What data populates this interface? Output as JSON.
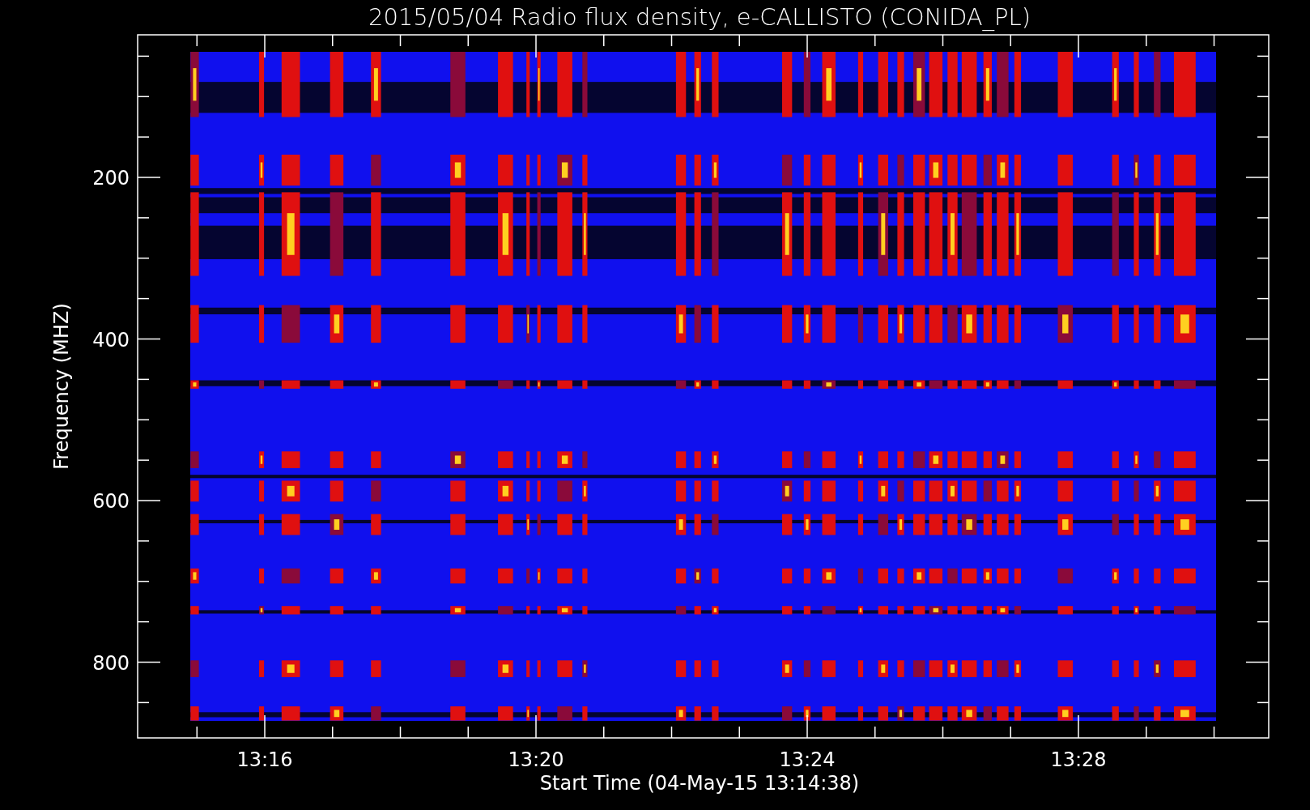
{
  "title": "2015/05/04  Radio flux density, e-CALLISTO (CONIDA_PL)",
  "y_axis": {
    "label": "Frequency (MHZ)",
    "ticks": [
      "200",
      "400",
      "600",
      "800"
    ]
  },
  "x_axis": {
    "label": "Start Time (04-May-15 13:14:38)",
    "ticks": [
      "13:16",
      "13:20",
      "13:24",
      "13:28"
    ]
  }
}
